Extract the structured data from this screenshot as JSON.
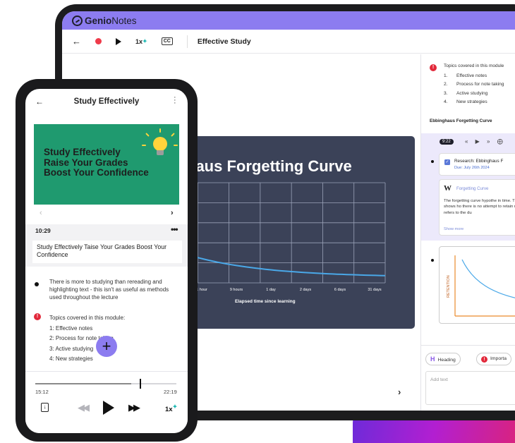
{
  "laptop": {
    "brand_bold": "Genio",
    "brand_rest": "Notes",
    "toolbar": {
      "back_icon": "arrow-left-icon",
      "speed": "1x",
      "cc": "CC",
      "doc_title": "Effective Study"
    },
    "slide": {
      "title": "haus Forgetting Curve",
      "x_labels": [
        "1 hour",
        "9 hours",
        "1 day",
        "2 days",
        "6 days",
        "31 days"
      ],
      "x_axis_title": "Elapsed time since learning"
    },
    "right_panel": {
      "intro": "Topics covered in this module",
      "topics": [
        {
          "num": "1.",
          "label": "Effective notes"
        },
        {
          "num": "2.",
          "label": "Process for note taking"
        },
        {
          "num": "3.",
          "label": "Active studying"
        },
        {
          "num": "4.",
          "label": "New strategies"
        }
      ],
      "section_heading": "Ebbinghaus Forgetting Curve",
      "timestamp": "9:22",
      "task_title": "Research: Ebbinghaus F",
      "task_due": "Due: July 26th 2024",
      "wiki_title": "Forgetting Curve",
      "wiki_text": "The forgetting curve hypothe in time. This curve shows ho there is no attempt to retain memory that refers to the du",
      "show_more": "Show more",
      "graph_axis_label": "RETENTION",
      "chip_heading": "Heading",
      "chip_important": "Importa",
      "input_placeholder": "Add text"
    }
  },
  "phone": {
    "title": "Study Effectively",
    "banner_lines": [
      "Study Effectively",
      "Raise Your Grades",
      "Boost Your Confidence"
    ],
    "note_time": "10:29",
    "note_text": "Study Effectively Taise Your Grades Boost Your Confidence",
    "bullet_text": "There is more to studying than rereading and highlighting text - this isn't as useful as methods used throughout the lecture",
    "topics_intro": "Topics covered in this module:",
    "topics": [
      "1: Effective notes",
      "2: Process for note taking",
      "3: Active studying",
      "4: New strategies"
    ],
    "fab_label": "+",
    "player": {
      "progress": 0.68,
      "time_elapsed": "15:12",
      "time_total": "22:19",
      "speed": "1x"
    }
  },
  "colors": {
    "accent": "#8c7cf0",
    "record": "#ef3b4a",
    "banner": "#1f9a6f",
    "slide_bg": "#3b4258",
    "curve": "#4aa8e8",
    "alert": "#e2283a"
  }
}
